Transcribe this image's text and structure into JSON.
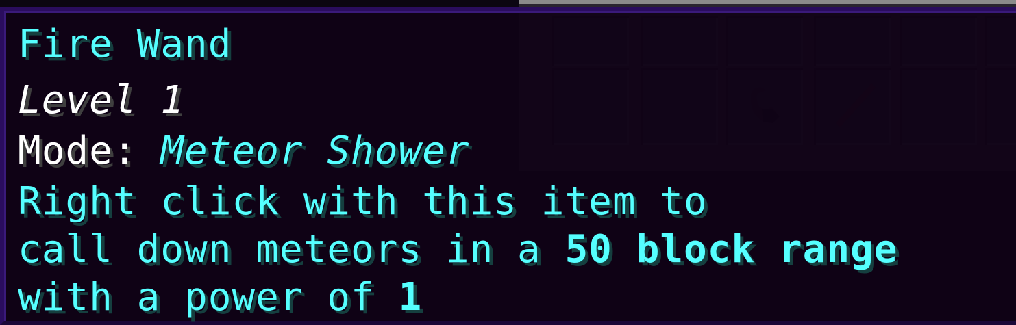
{
  "tooltip": {
    "item_name": "Fire Wand",
    "level_text": "Level 1",
    "mode_label": "Mode:",
    "mode_value": "Meteor Shower",
    "description_line1": "Right click with this item to",
    "description_line2_prefix": "call down meteors in a",
    "description_line2_highlight": "50 block range",
    "description_line3_prefix": "with a power of",
    "description_line3_highlight": "1"
  },
  "colors": {
    "aqua_text": "#55ffff",
    "white_text": "#ffffff",
    "tooltip_background": "#100216",
    "tooltip_border": "#2a0d5e"
  },
  "inventory": {
    "visible_items": [
      "totem-icon",
      "stick-icon"
    ]
  }
}
